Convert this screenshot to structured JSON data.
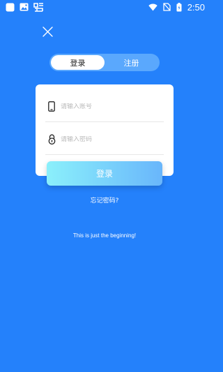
{
  "status_bar": {
    "time": "2:50",
    "left_icons": [
      "app-square-icon",
      "image-icon",
      "sim-app-icon"
    ],
    "right_icons": [
      "wifi-icon",
      "no-signal-icon",
      "battery-charging-icon"
    ]
  },
  "header": {
    "close_icon": "close-icon"
  },
  "tabs": [
    {
      "label": "登录",
      "active": true
    },
    {
      "label": "注册",
      "active": false
    }
  ],
  "form": {
    "account": {
      "placeholder": "请输入账号",
      "value": "",
      "icon": "phone-icon"
    },
    "password": {
      "placeholder": "请输入密码",
      "value": "",
      "icon": "lock-icon"
    }
  },
  "login_button": {
    "label": "登录"
  },
  "forgot_password": "忘记密码?",
  "slogan": "This is just the beginning!",
  "colors": {
    "background": "#2481fb",
    "tab_track": "#5aa8fd",
    "button_gradient_start": "#8bf0fb",
    "button_gradient_end": "#69b6fb"
  }
}
